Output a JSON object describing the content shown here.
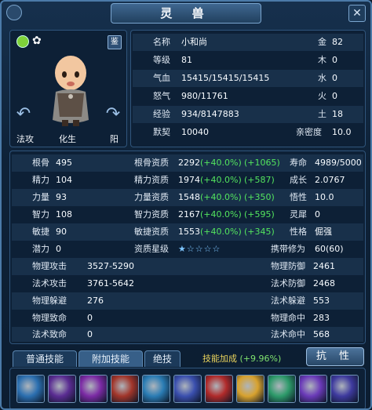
{
  "title": "灵  兽",
  "portrait": {
    "mode_left": "法攻",
    "mode_middle": "化生",
    "mode_right": "阳",
    "badge": "鉴"
  },
  "top": [
    {
      "k1": "名称",
      "v1": "小和尚",
      "k2": "金",
      "v2": "82"
    },
    {
      "k1": "等级",
      "v1": "81",
      "k2": "木",
      "v2": "0"
    },
    {
      "k1": "气血",
      "v1": "15415/15415/15415",
      "k2": "水",
      "v2": "0"
    },
    {
      "k1": "怒气",
      "v1": "980/11761",
      "k2": "火",
      "v2": "0"
    },
    {
      "k1": "经验",
      "v1": "934/8147883",
      "k2": "土",
      "v2": "18"
    },
    {
      "k1": "默契",
      "v1": "10040",
      "k2": "亲密度",
      "v2": "10.0"
    }
  ],
  "main": [
    {
      "k1": "根骨",
      "v1": "495",
      "k2": "根骨资质",
      "base": "2292",
      "pct": "(+40.0%)",
      "add": "(+1065)",
      "k3": "寿命",
      "v3": "4989/5000"
    },
    {
      "k1": "精力",
      "v1": "104",
      "k2": "精力资质",
      "base": "1974",
      "pct": "(+40.0%)",
      "add": "(+587)",
      "k3": "成长",
      "v3": "2.0767"
    },
    {
      "k1": "力量",
      "v1": "93",
      "k2": "力量资质",
      "base": "1548",
      "pct": "(+40.0%)",
      "add": "(+350)",
      "k3": "悟性",
      "v3": "10.0"
    },
    {
      "k1": "智力",
      "v1": "108",
      "k2": "智力资质",
      "base": "2167",
      "pct": "(+40.0%)",
      "add": "(+595)",
      "k3": "灵犀",
      "v3": "0"
    },
    {
      "k1": "敏捷",
      "v1": "90",
      "k2": "敏捷资质",
      "base": "1553",
      "pct": "(+40.0%)",
      "add": "(+345)",
      "k3": "性格",
      "v3": "倔强"
    },
    {
      "k1": "潜力",
      "v1": "0",
      "k2": "资质星级",
      "stars": "★☆☆☆☆",
      "k3": "携带修为",
      "v3": "60(60)"
    }
  ],
  "combat": [
    {
      "k1": "物理攻击",
      "v1": "3527-5290",
      "k2": "物理防御",
      "v2": "2461"
    },
    {
      "k1": "法术攻击",
      "v1": "3761-5642",
      "k2": "法术防御",
      "v2": "2468"
    },
    {
      "k1": "物理躲避",
      "v1": "276",
      "k2": "法术躲避",
      "v2": "553"
    },
    {
      "k1": "物理致命",
      "v1": "0",
      "k2": "物理命中",
      "v2": "283"
    },
    {
      "k1": "法术致命",
      "v1": "0",
      "k2": "法术命中",
      "v2": "568"
    }
  ],
  "tabs": [
    "普通技能",
    "附加技能",
    "绝技"
  ],
  "bonus_label": "技能加成",
  "bonus_value": "(+9.96%)",
  "resist_label": "抗 性",
  "skills": [
    {
      "name": "skill-1",
      "color": "#2b6fb0"
    },
    {
      "name": "skill-2",
      "color": "#5a2c92"
    },
    {
      "name": "skill-3",
      "color": "#7b2aa4"
    },
    {
      "name": "skill-4",
      "color": "#a1352a"
    },
    {
      "name": "skill-5",
      "color": "#2a7cb4"
    },
    {
      "name": "skill-6",
      "color": "#3a4fae"
    },
    {
      "name": "skill-7",
      "color": "#b02a2a"
    },
    {
      "name": "skill-8",
      "color": "#d8a22e"
    },
    {
      "name": "skill-9",
      "color": "#2d9a6a"
    },
    {
      "name": "skill-10",
      "color": "#6a3ab8"
    },
    {
      "name": "skill-11",
      "color": "#3e3a9e"
    }
  ]
}
